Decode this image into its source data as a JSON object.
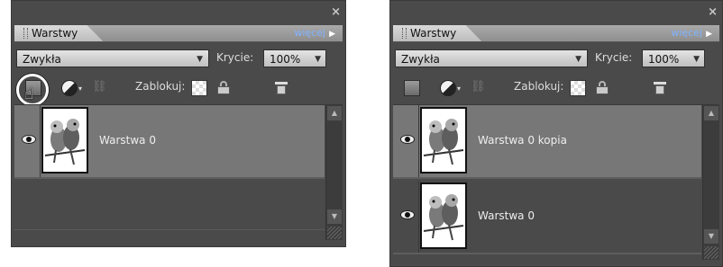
{
  "panels": [
    {
      "close": "×",
      "tab_label": "Warstwy",
      "more_label": "więcej",
      "more_arrow": "▶",
      "blend_mode": "Zwykła",
      "opacity_label": "Krycie:",
      "opacity_value": "100%",
      "lock_label": "Zablokuj:",
      "layers": [
        {
          "name": "Warstwa 0",
          "selected": true
        }
      ]
    },
    {
      "close": "×",
      "tab_label": "Warstwy",
      "more_label": "więcej",
      "more_arrow": "▶",
      "blend_mode": "Zwykła",
      "opacity_label": "Krycie:",
      "opacity_value": "100%",
      "lock_label": "Zablokuj:",
      "layers": [
        {
          "name": "Warstwa 0 kopia",
          "selected": true
        },
        {
          "name": "Warstwa 0",
          "selected": false
        }
      ]
    }
  ],
  "icons": [
    "eye-icon",
    "new-layer-icon",
    "adjustment-layer-icon",
    "link-icon",
    "lock-transparent-icon",
    "lock-all-icon",
    "trash-icon",
    "hand-cursor-icon"
  ],
  "colors": {
    "panel_bg": "#4a4a4a",
    "selected_row": "#777777",
    "more_link": "#7fb2ff"
  }
}
